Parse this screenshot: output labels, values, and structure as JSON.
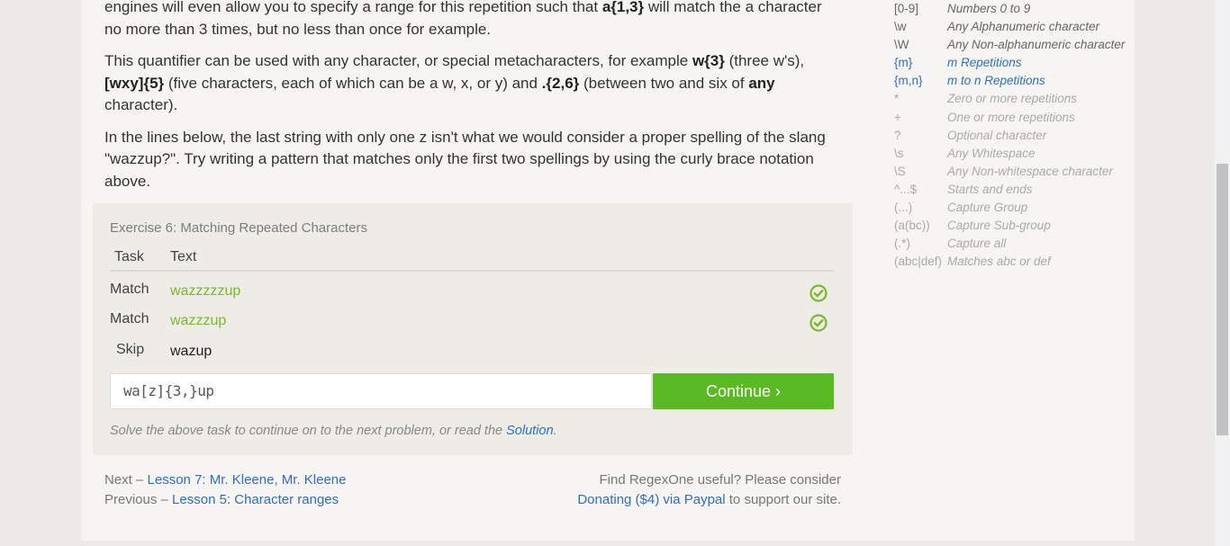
{
  "lesson": {
    "p1": [
      {
        "t": "engines will even allow you to specify a range for this repetition such that "
      },
      {
        "t": "a{1,3}",
        "b": true
      },
      {
        "t": " will match the a character no more than 3 times, but no less than once for example."
      }
    ],
    "p2": [
      {
        "t": "This quantifier can be used with any character, or special metacharacters, for example "
      },
      {
        "t": "w{3}",
        "b": true
      },
      {
        "t": " (three w's), "
      },
      {
        "t": "[wxy]{5}",
        "b": true
      },
      {
        "t": " (five characters, each of which can be a w, x, or y) and "
      },
      {
        "t": ".{2,6}",
        "b": true
      },
      {
        "t": " (between two and six of "
      },
      {
        "t": "any",
        "b": true
      },
      {
        "t": " character)."
      }
    ],
    "p3": "In the lines below, the last string with only one z isn't what we would consider a proper spelling of the slang \"wazzup?\". Try writing a pattern that matches only the first two spellings by using the curly brace notation above."
  },
  "exercise": {
    "title": "Exercise 6: Matching Repeated Characters",
    "col_task": "Task",
    "col_text": "Text",
    "rows": [
      {
        "task": "Match",
        "text": "wazzzzzup",
        "status": "ok"
      },
      {
        "task": "Match",
        "text": "wazzzup",
        "status": "ok"
      },
      {
        "task": "Skip",
        "text": "wazup",
        "status": "none"
      }
    ],
    "input_value": "wa[z]{3,}up",
    "continue_label": "Continue ›",
    "solve_text": "Solve the above task to continue on to the next problem, or read the ",
    "solution_link": "Solution",
    "solve_end": "."
  },
  "nav": {
    "next_prefix": "Next – ",
    "next_link": "Lesson 7: Mr. Kleene, Mr. Kleene",
    "prev_prefix": "Previous – ",
    "prev_link": "Lesson 5: Character ranges",
    "donate_text": "Find RegexOne useful? Please consider",
    "donate_link": "Donating ($4) via Paypal",
    "donate_suffix": " to support our site."
  },
  "cheatsheet": [
    {
      "sym": "[0-9]",
      "desc": "Numbers 0 to 9",
      "state": "normal"
    },
    {
      "sym": "\\w",
      "desc": "Any Alphanumeric character",
      "state": "normal"
    },
    {
      "sym": "\\W",
      "desc": "Any Non-alphanumeric character",
      "state": "normal"
    },
    {
      "sym": "{m}",
      "desc": "m Repetitions",
      "state": "hl"
    },
    {
      "sym": "{m,n}",
      "desc": "m to n Repetitions",
      "state": "hl"
    },
    {
      "sym": "*",
      "desc": "Zero or more repetitions",
      "state": "dim"
    },
    {
      "sym": "+",
      "desc": "One or more repetitions",
      "state": "dim"
    },
    {
      "sym": "?",
      "desc": "Optional character",
      "state": "dim"
    },
    {
      "sym": "\\s",
      "desc": "Any Whitespace",
      "state": "dim"
    },
    {
      "sym": "\\S",
      "desc": "Any Non-whitespace character",
      "state": "dim"
    },
    {
      "sym": "^...$",
      "desc": "Starts and ends",
      "state": "dim"
    },
    {
      "sym": "(...)",
      "desc": "Capture Group",
      "state": "dim"
    },
    {
      "sym": "(a(bc))",
      "desc": "Capture Sub-group",
      "state": "dim"
    },
    {
      "sym": "(.*)",
      "desc": "Capture all",
      "state": "dim"
    },
    {
      "sym": "(abc|def)",
      "desc": "Matches abc or def",
      "state": "dim"
    }
  ],
  "colors": {
    "accent": "#5aba24",
    "link": "#2f6fc4",
    "ok": "#7ab929"
  },
  "icons": {
    "row_status": "check-circle-icon"
  }
}
